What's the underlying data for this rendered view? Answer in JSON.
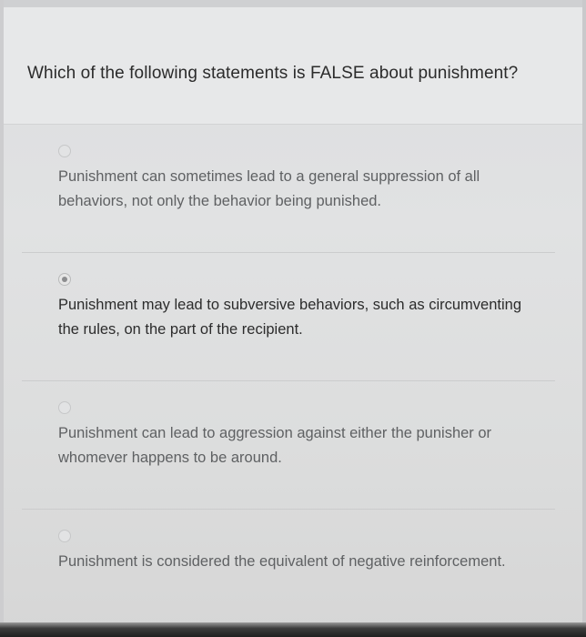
{
  "question": {
    "text": "Which of the following statements is FALSE about punishment?"
  },
  "options": [
    {
      "text": "Punishment can sometimes lead to a general suppression of all behaviors, not only the behavior being punished.",
      "selected": false
    },
    {
      "text": "Punishment may lead to subversive behaviors, such as circumventing the rules, on the part of the recipient.",
      "selected": true
    },
    {
      "text": "Punishment can lead to aggression against either the punisher or whomever happens to be around.",
      "selected": false
    },
    {
      "text": "Punishment is considered the equivalent of negative reinforcement.",
      "selected": false
    }
  ],
  "colors": {
    "page_bg": "#e1e2e3",
    "question_text": "#2b2b2b",
    "option_text": "#5f6163",
    "selected_option_text": "#2c2c2c",
    "divider": "#cbcccd"
  }
}
